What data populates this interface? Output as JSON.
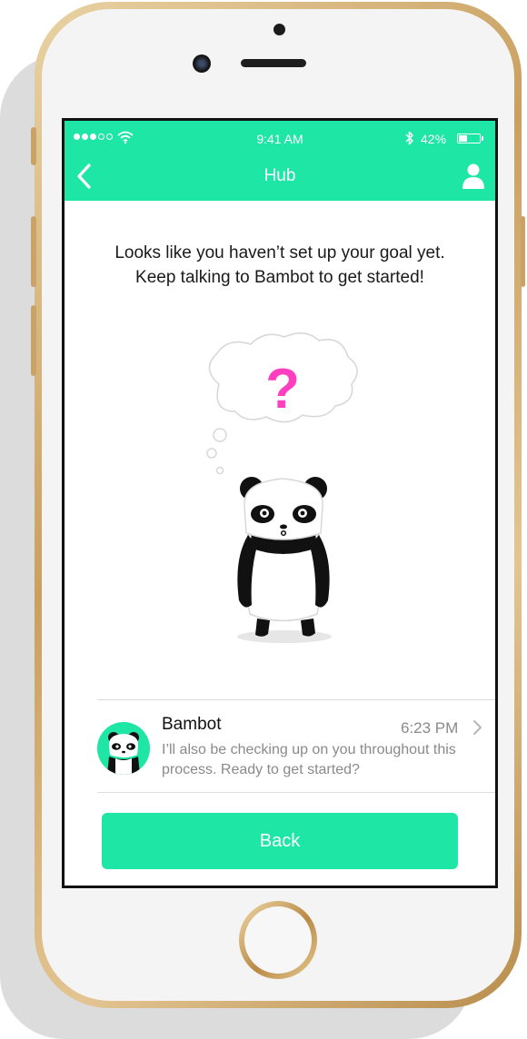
{
  "status_bar": {
    "time": "9:41 AM",
    "battery_percent": "42%",
    "battery_level": 0.42,
    "signal_bars": 3
  },
  "nav": {
    "title": "Hub",
    "back_icon": "chevron-left-icon",
    "profile_icon": "user-icon"
  },
  "main": {
    "message_line1": "Looks like you haven’t set up your goal yet.",
    "message_line2": "Keep talking to Bambot to get started!",
    "thought_symbol": "?"
  },
  "chat": {
    "name": "Bambot",
    "time": "6:23 PM",
    "preview": "I’ll also be checking up on you throughout this process. Ready to get started?"
  },
  "actions": {
    "back_label": "Back"
  },
  "colors": {
    "accent": "#1ee6a4",
    "question_mark": "#ff3fbf"
  }
}
